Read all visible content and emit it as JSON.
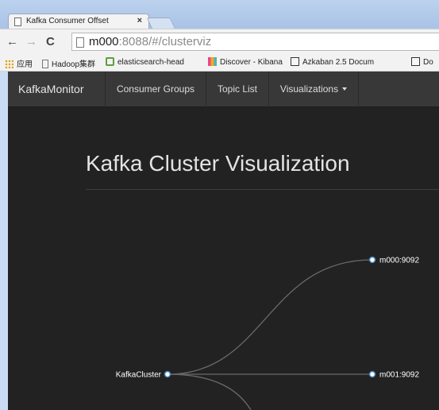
{
  "browser": {
    "tab_title": "Kafka Consumer Offset",
    "tab_close": "×",
    "back": "←",
    "forward": "→",
    "reload": "C",
    "url_host": "m000",
    "url_rest": ":8088/#/clusterviz"
  },
  "bookmarks": [
    {
      "label": "应用",
      "icon": "apps-grid-icon",
      "color": "#e0a000"
    },
    {
      "label": "Hadoop集群",
      "icon": "page-icon",
      "color": "#777777"
    },
    {
      "label": "elasticsearch-head",
      "icon": "elastic-icon",
      "color": "#5f9e3f"
    },
    {
      "label": "Discover - Kibana",
      "icon": "kibana-icon",
      "color": "#e8488b"
    },
    {
      "label": "Azkaban 2.5 Docum",
      "icon": "azkaban-icon",
      "color": "#333333"
    },
    {
      "label": "Do",
      "icon": "azkaban-icon",
      "color": "#333333"
    }
  ],
  "navbar": {
    "brand": "KafkaMonitor",
    "items": [
      "Consumer Groups",
      "Topic List",
      "Visualizations"
    ]
  },
  "heading": "Kafka Cluster Visualization",
  "viz": {
    "root": "KafkaCluster",
    "children": [
      "m000:9092",
      "m001:9092"
    ]
  }
}
